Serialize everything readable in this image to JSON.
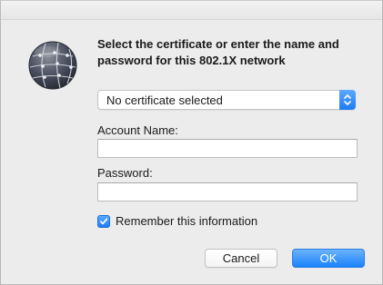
{
  "dialog": {
    "message": "Select the certificate or enter the name and password for this 802.1X network",
    "icon": "network-globe-icon"
  },
  "certificate_popup": {
    "selected": "No certificate selected"
  },
  "account": {
    "label": "Account Name:",
    "value": ""
  },
  "password": {
    "label": "Password:",
    "value": ""
  },
  "remember": {
    "label": "Remember this information",
    "checked": true
  },
  "buttons": {
    "cancel": "Cancel",
    "ok": "OK"
  },
  "colors": {
    "accent": "#1a82fb",
    "window_bg": "#ececec"
  }
}
